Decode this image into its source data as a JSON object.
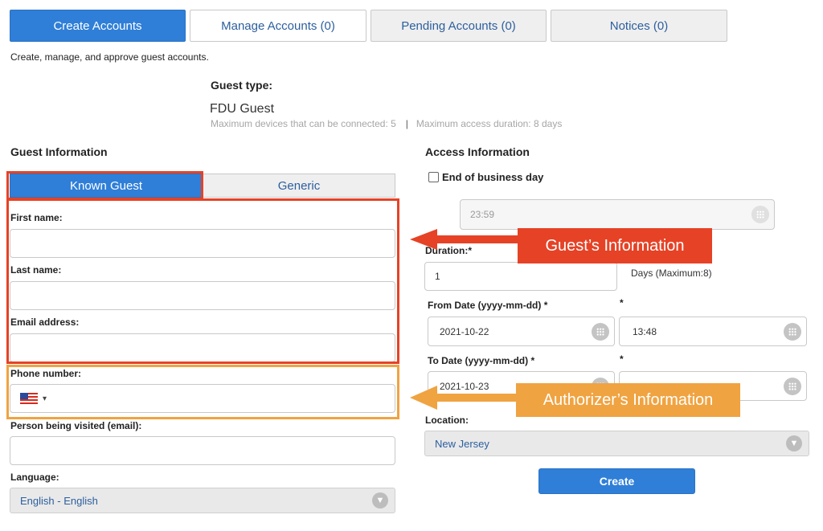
{
  "tabs": [
    {
      "label": "Create Accounts",
      "active": true
    },
    {
      "label": "Manage Accounts (0)"
    },
    {
      "label": "Pending Accounts (0)"
    },
    {
      "label": "Notices (0)"
    }
  ],
  "subtitle": "Create, manage, and approve guest accounts.",
  "guest_type": {
    "label": "Guest type:",
    "value": "FDU Guest",
    "max_devices": "Maximum devices that can be connected: 5",
    "separator": "|",
    "max_duration": "Maximum access duration: 8 days"
  },
  "guest_info": {
    "title": "Guest Information",
    "subtabs": [
      "Known Guest",
      "Generic"
    ],
    "first_name_label": "First name:",
    "last_name_label": "Last name:",
    "email_label": "Email address:",
    "phone_label": "Phone number:",
    "visited_label": "Person being visited (email):",
    "language_label": "Language:",
    "language_value": "English - English",
    "phone_caret": "▾"
  },
  "access_info": {
    "title": "Access Information",
    "end_of_day_label": "End of business day",
    "end_time_value": "23:59",
    "duration_label": "Duration:*",
    "duration_value": "1",
    "duration_hint": "Days (Maximum:8)",
    "from_date_label": "From Date (yyyy-mm-dd) *",
    "from_time_required": "*",
    "from_date_value": "2021-10-22",
    "from_time_value": "13:48",
    "to_date_label": "To Date (yyyy-mm-dd) *",
    "to_time_required": "*",
    "to_date_value": "2021-10-23",
    "location_label": "Location:",
    "location_value": "New Jersey",
    "create_label": "Create"
  },
  "annotations": {
    "guest_callout": "Guest’s Information",
    "authorizer_callout": "Authorizer’s Information",
    "red": "#e64226",
    "orange": "#f0a341"
  },
  "colors": {
    "accent": "#2f7fd8",
    "link_text": "#2c5f9e"
  }
}
